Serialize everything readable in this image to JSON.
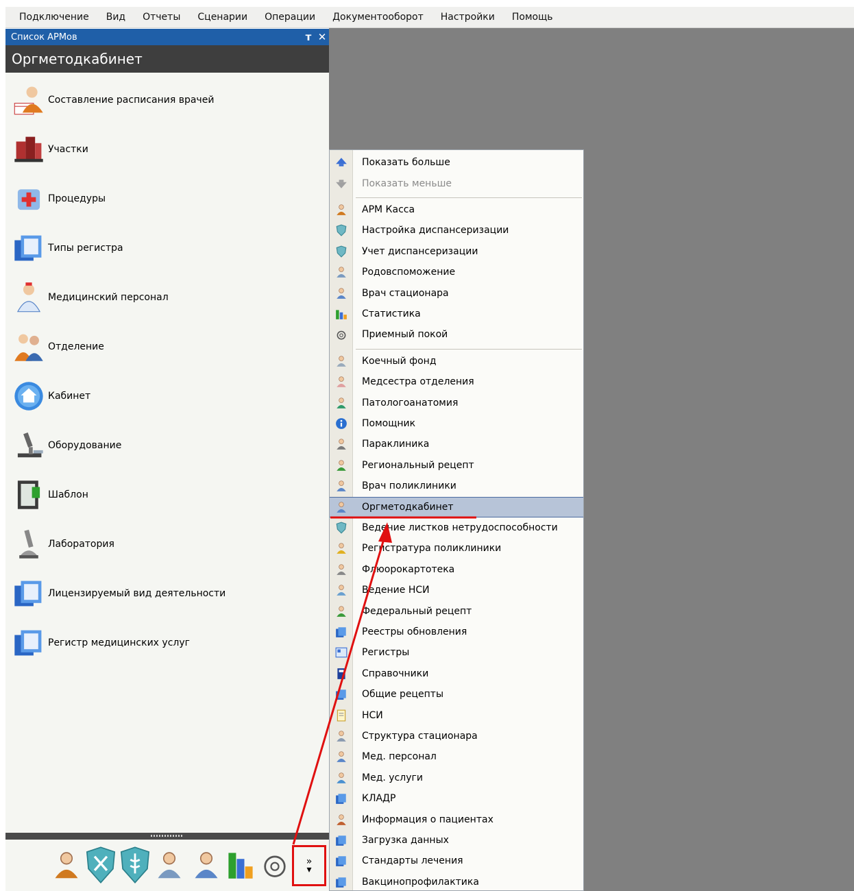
{
  "menubar": {
    "items": [
      "Подключение",
      "Вид",
      "Отчеты",
      "Сценарии",
      "Операции",
      "Документооборот",
      "Настройки",
      "Помощь"
    ]
  },
  "panel": {
    "title": "Список АРМов",
    "pin_glyph": "т",
    "close_glyph": "✕",
    "header": "Оргметодкабинет",
    "items": [
      {
        "label": "Составление расписания врачей",
        "icon": "doctor-schedule-icon"
      },
      {
        "label": "Участки",
        "icon": "buildings-icon"
      },
      {
        "label": "Процедуры",
        "icon": "procedures-icon"
      },
      {
        "label": "Типы регистра",
        "icon": "register-folder-icon"
      },
      {
        "label": "Медицинский персонал",
        "icon": "medical-staff-icon"
      },
      {
        "label": "Отделение",
        "icon": "department-people-icon"
      },
      {
        "label": "Кабинет",
        "icon": "house-icon"
      },
      {
        "label": "Оборудование",
        "icon": "microscope-icon"
      },
      {
        "label": "Шаблон",
        "icon": "template-book-icon"
      },
      {
        "label": "Лаборатория",
        "icon": "laboratory-microscope-icon"
      },
      {
        "label": "Лицензируемый вид деятельности",
        "icon": "license-folder-icon"
      },
      {
        "label": "Регистр медицинских услуг",
        "icon": "services-folder-icon"
      }
    ],
    "overflow_glyph": "»"
  },
  "bottombar": {
    "icons": [
      "cashier-icon",
      "tools-shield-icon",
      "caduceus-shield-icon",
      "obstetrics-icon",
      "hospital-doctor-icon",
      "statistics-icon",
      "stethoscope-icon"
    ]
  },
  "dropdown": {
    "group1": [
      {
        "label": "Показать больше",
        "icon": "arrow-up-icon",
        "disabled": false
      },
      {
        "label": "Показать меньше",
        "icon": "arrow-down-icon",
        "disabled": true
      }
    ],
    "group2": [
      {
        "label": "АРМ Касса",
        "icon": "cashier-icon"
      },
      {
        "label": "Настройка диспансеризации",
        "icon": "shield-icon"
      },
      {
        "label": "Учет диспансеризации",
        "icon": "shield-icon"
      },
      {
        "label": "Родовспоможение",
        "icon": "obstetrics-icon"
      },
      {
        "label": "Врач стационара",
        "icon": "doctor-icon"
      },
      {
        "label": "Статистика",
        "icon": "statistics-icon"
      },
      {
        "label": "Приемный покой",
        "icon": "stethoscope-icon"
      }
    ],
    "group3": [
      {
        "label": "Коечный фонд",
        "icon": "bed-icon"
      },
      {
        "label": "Медсестра отделения",
        "icon": "nurse-icon"
      },
      {
        "label": "Патологоанатомия",
        "icon": "pathology-icon"
      },
      {
        "label": "Помощник",
        "icon": "info-icon"
      },
      {
        "label": "Параклиника",
        "icon": "paraclinic-icon"
      },
      {
        "label": "Региональный рецепт",
        "icon": "prescription-icon"
      },
      {
        "label": "Врач поликлиники",
        "icon": "doctor-icon"
      },
      {
        "label": "Оргметодкабинет",
        "icon": "doctor-icon",
        "selected": true
      },
      {
        "label": "Ведение листков нетрудоспособности",
        "icon": "shield-icon"
      },
      {
        "label": "Регистратура поликлиники",
        "icon": "registry-icon"
      },
      {
        "label": "Флюорокартотека",
        "icon": "fluoro-icon"
      },
      {
        "label": "Ведение НСИ",
        "icon": "nsi-icon"
      },
      {
        "label": "Федеральный рецепт",
        "icon": "prescription-icon"
      },
      {
        "label": "Реестры обновления",
        "icon": "folder-icon"
      },
      {
        "label": "Регистры",
        "icon": "registers-icon"
      },
      {
        "label": "Справочники",
        "icon": "book-icon"
      },
      {
        "label": "Общие рецепты",
        "icon": "folder-icon"
      },
      {
        "label": "НСИ",
        "icon": "document-icon"
      },
      {
        "label": "Структура стационара",
        "icon": "structure-icon"
      },
      {
        "label": "Мед. персонал",
        "icon": "doctor-icon"
      },
      {
        "label": "Мед. услуги",
        "icon": "services-icon"
      },
      {
        "label": "КЛАДР",
        "icon": "folder-icon"
      },
      {
        "label": "Информация о пациентах",
        "icon": "patients-icon"
      },
      {
        "label": "Загрузка данных",
        "icon": "folder-icon"
      },
      {
        "label": "Стандарты лечения",
        "icon": "folder-icon"
      },
      {
        "label": "Вакцинопрофилактика",
        "icon": "folder-icon"
      }
    ]
  },
  "colors": {
    "panel_title": "#1f5fa8",
    "panel_header": "#3e3e3e",
    "workspace": "#808080",
    "selection": "#b7c4d8",
    "annotation": "#e01010"
  }
}
